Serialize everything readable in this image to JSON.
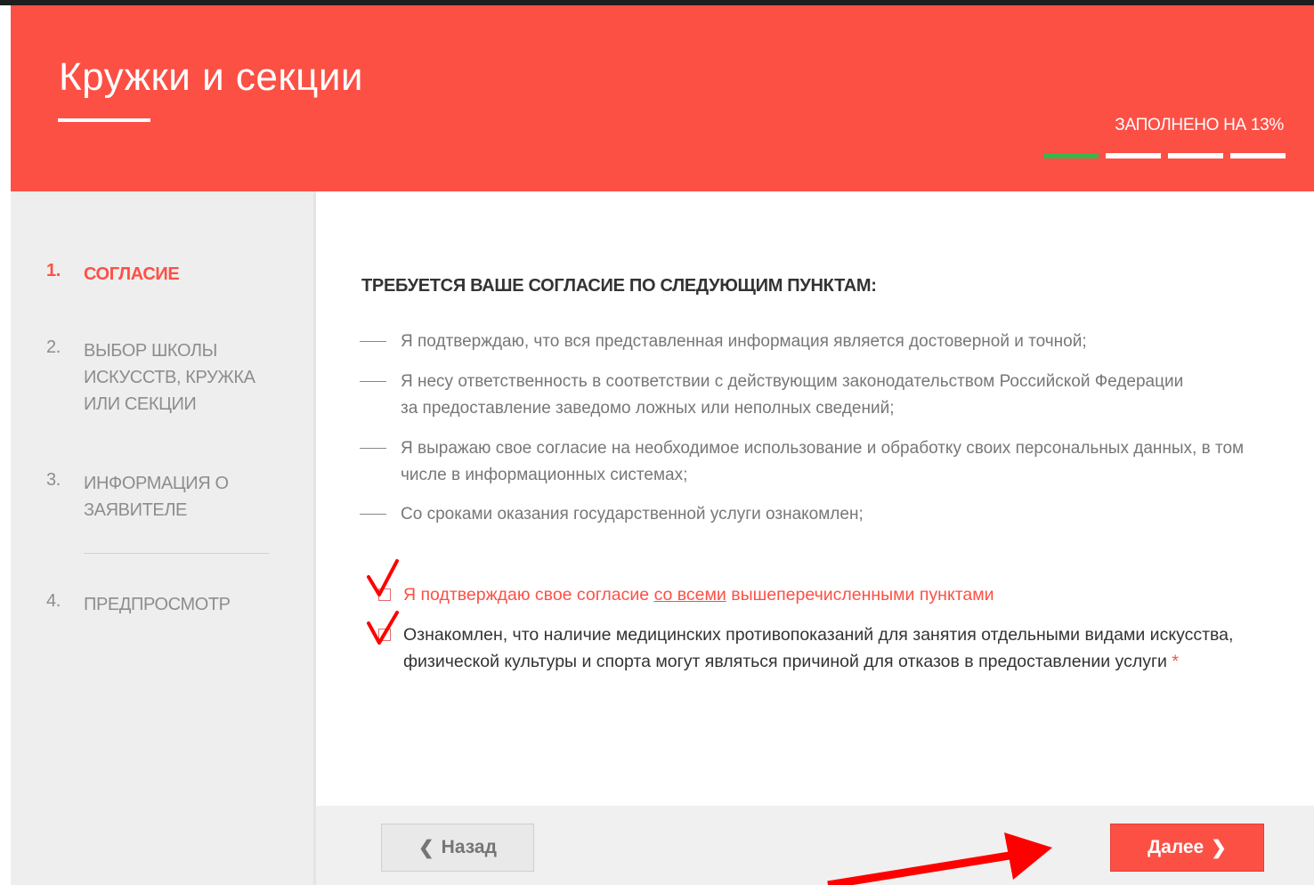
{
  "header": {
    "title": "Кружки и секции",
    "progress_label": "ЗАПОЛНЕНО НА 13%",
    "progress_fraction": 0.13,
    "progress_segments": 4,
    "progress_done_segments": 1
  },
  "sidebar": {
    "steps": [
      {
        "num": "1.",
        "label": "СОГЛАСИЕ",
        "active": true
      },
      {
        "num": "2.",
        "label": "ВЫБОР ШКОЛЫ ИСКУССТВ, КРУЖКА ИЛИ СЕКЦИИ",
        "active": false
      },
      {
        "num": "3.",
        "label": "ИНФОРМАЦИЯ О ЗАЯВИТЕЛЕ",
        "active": false
      },
      {
        "num": "4.",
        "label": "ПРЕДПРОСМОТР",
        "active": false
      }
    ]
  },
  "content": {
    "title": "ТРЕБУЕТСЯ ВАШЕ СОГЛАСИЕ ПО СЛЕДУЮЩИМ ПУНКТАМ:",
    "terms": [
      "Я подтверждаю, что вся представленная информация является достоверной и точной;",
      "Я несу ответственность в соответствии с действующим законодательством Российской Федерации за предоставление заведомо ложных или неполных сведений;",
      "Я выражаю свое согласие на необходимое использование и обработку своих персональных данных, в том числе в информационных системах;",
      "Со сроками оказания государственной услуги ознакомлен;"
    ],
    "consent_all": {
      "before": "Я подтверждаю свое согласие ",
      "link": "со всеми",
      "after": " вышеперечисленными пунктами"
    },
    "medical_ack": "Ознакомлен, что наличие медицинских противопоказаний для занятия отдельными видами искусства, физической культуры и спорта могут являться причиной для отказов в предоставлении услуги",
    "required_mark": "*"
  },
  "footer": {
    "back_label": "Назад",
    "next_label": "Далее"
  },
  "colors": {
    "brand": "#fd5045",
    "progress_done": "#39b54a",
    "annotation": "#ff0000"
  }
}
